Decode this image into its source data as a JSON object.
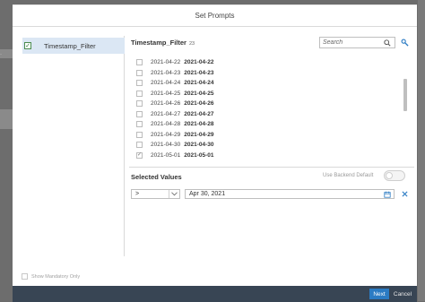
{
  "dialog": {
    "title": "Set Prompts"
  },
  "left_panel": {
    "items": [
      {
        "label": "Timestamp_Filter",
        "checked": true
      }
    ]
  },
  "filter": {
    "title": "Timestamp_Filter",
    "count": "23",
    "search_placeholder": "Search",
    "search_icon": "magnifier-icon",
    "settings_icon": "settings-icon",
    "rows": [
      {
        "key": "2021-04-22",
        "value": "2021-04-22",
        "checked": false
      },
      {
        "key": "2021-04-23",
        "value": "2021-04-23",
        "checked": false
      },
      {
        "key": "2021-04-24",
        "value": "2021-04-24",
        "checked": false
      },
      {
        "key": "2021-04-25",
        "value": "2021-04-25",
        "checked": false
      },
      {
        "key": "2021-04-26",
        "value": "2021-04-26",
        "checked": false
      },
      {
        "key": "2021-04-27",
        "value": "2021-04-27",
        "checked": false
      },
      {
        "key": "2021-04-28",
        "value": "2021-04-28",
        "checked": false
      },
      {
        "key": "2021-04-29",
        "value": "2021-04-29",
        "checked": false
      },
      {
        "key": "2021-04-30",
        "value": "2021-04-30",
        "checked": false
      },
      {
        "key": "2021-05-01",
        "value": "2021-05-01",
        "checked": true
      }
    ]
  },
  "selected_values": {
    "title": "Selected Values",
    "backend_default_label": "Use Backend Default",
    "backend_default_on": false,
    "operator": ">",
    "date_value": "Apr 30, 2021",
    "calendar_icon": "calendar-icon",
    "remove_icon": "close-icon"
  },
  "footer": {
    "mandatory_label": "Show Mandatory Only",
    "next_label": "Next",
    "cancel_label": "Cancel"
  },
  "colors": {
    "accent": "#2b7bc3",
    "footer_bg": "#384554",
    "selected_item_bg": "#dbe7f4"
  }
}
